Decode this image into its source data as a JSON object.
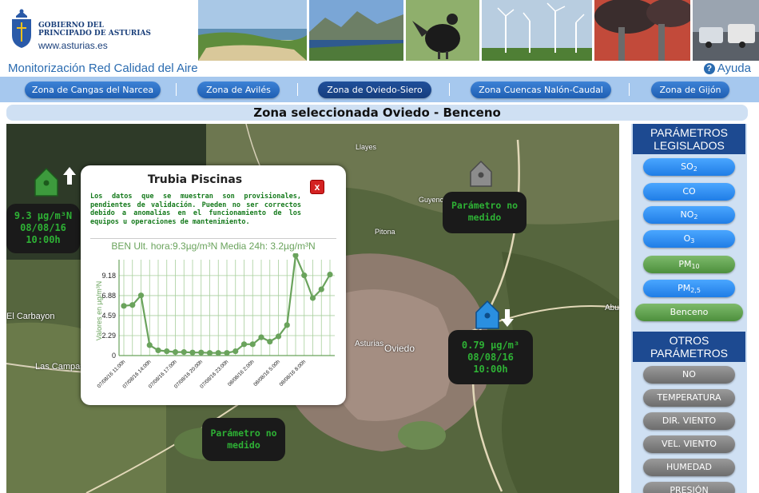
{
  "header": {
    "gov_line1": "GOBIERNO DEL",
    "gov_line2": "PRINCIPADO DE ASTURIAS",
    "gov_url": "www.asturias.es"
  },
  "titlebar": {
    "app_title": "Monitorización Red Calidad del Aire",
    "help_label": "Ayuda"
  },
  "nav": {
    "zones": [
      "Zona de Cangas del Narcea",
      "Zona de Avilés",
      "Zona de Oviedo-Siero",
      "Zona Cuencas Nalón-Caudal",
      "Zona de Gijón"
    ],
    "active_index": 2
  },
  "zone_title": "Zona seleccionada Oviedo - Benceno",
  "map": {
    "labels": [
      "Llayes",
      "Guyence",
      "Pitona",
      "El Carbayon",
      "Las Campas",
      "Asturias",
      "Oviedo",
      "Abu"
    ],
    "stations": [
      {
        "value": "9.3 µg/m³N",
        "date": "08/08/16",
        "time": "10:00h"
      },
      {
        "text": "Parámetro no medido"
      },
      {
        "value": "0.79 µg/m³",
        "date": "08/08/16",
        "time": "10:00h"
      },
      {
        "text": "Parámetro no medido"
      }
    ]
  },
  "popup": {
    "title": "Trubia Piscinas",
    "close_label": "x",
    "note": "Los datos que se muestran son provisionales, pendientes de validación. Pueden no ser correctos debido a anomalías en el funcionamiento de los equipos u operaciones de mantenimiento.",
    "chart_header": "BEN Ult. hora:9.3µg/m³N Media 24h: 3.2µg/m³N"
  },
  "chart_data": {
    "type": "line",
    "ylabel": "Valores en µg/m³N",
    "yticks": [
      0,
      2.29,
      4.59,
      6.88,
      9.18
    ],
    "ylim": [
      0,
      11.0
    ],
    "xticks": [
      "07/08/16 11:00h",
      "07/08/16 14:00h",
      "07/08/16 17:00h",
      "07/08/16 20:00h",
      "07/08/16 23:00h",
      "08/08/16 2:00h",
      "08/08/16 5:00h",
      "08/08/16 8:00h"
    ],
    "values": [
      5.7,
      5.8,
      6.9,
      1.2,
      0.6,
      0.5,
      0.4,
      0.4,
      0.35,
      0.35,
      0.3,
      0.3,
      0.3,
      0.5,
      1.3,
      1.3,
      2.1,
      1.6,
      2.2,
      3.5,
      11.5,
      9.2,
      6.6,
      7.6,
      9.3
    ],
    "color": "#6aa35c"
  },
  "sidebar": {
    "legislados_title": "PARÁMETROS LEGISLADOS",
    "legislados": [
      {
        "base": "SO",
        "sub": "2",
        "style": "blue"
      },
      {
        "base": "CO",
        "sub": "",
        "style": "blue"
      },
      {
        "base": "NO",
        "sub": "2",
        "style": "blue"
      },
      {
        "base": "O",
        "sub": "3",
        "style": "blue"
      },
      {
        "base": "PM",
        "sub": "10",
        "style": "green"
      },
      {
        "base": "PM",
        "sub": "2,5",
        "style": "blue"
      },
      {
        "base": "Benceno",
        "sub": "",
        "style": "green"
      }
    ],
    "otros_title": "OTROS PARÁMETROS",
    "otros": [
      "NO",
      "TEMPERATURA",
      "DIR. VIENTO",
      "VEL. VIENTO",
      "HUMEDAD",
      "PRESIÓN"
    ]
  },
  "colors": {
    "nav_bg": "#a6c8ee",
    "button_blue": "#1f7de6",
    "sidebar_head": "#1d4a91",
    "value_green": "#2eb135"
  }
}
